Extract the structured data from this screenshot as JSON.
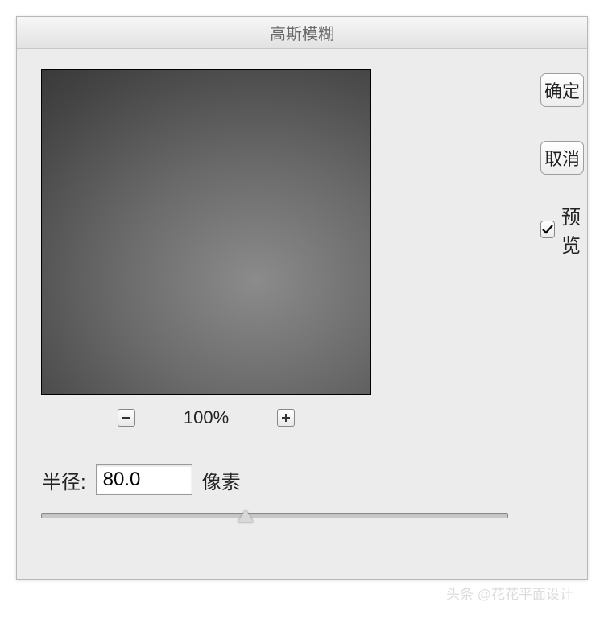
{
  "dialog": {
    "title": "高斯模糊"
  },
  "preview": {
    "zoom_level": "100%"
  },
  "radius": {
    "label": "半径:",
    "value": "80.0",
    "unit": "像素"
  },
  "actions": {
    "ok": "确定",
    "cancel": "取消"
  },
  "preview_check": {
    "label": "预览",
    "checked": true
  },
  "watermark": "头条 @花花平面设计"
}
